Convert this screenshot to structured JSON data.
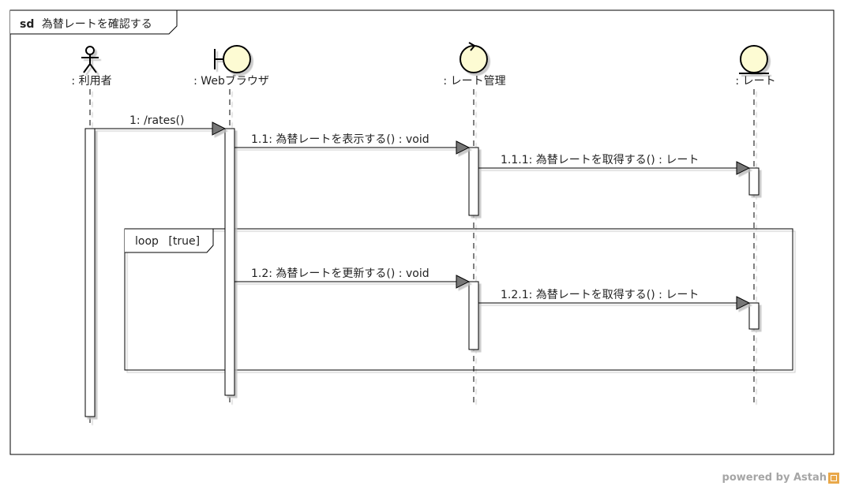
{
  "frame": {
    "keyword": "sd",
    "name": "為替レートを確認する"
  },
  "lifelines": [
    {
      "id": "user",
      "label": ": 利用者",
      "stereotype": "actor"
    },
    {
      "id": "browser",
      "label": ": Webブラウザ",
      "stereotype": "boundary"
    },
    {
      "id": "manager",
      "label": ": レート管理",
      "stereotype": "control"
    },
    {
      "id": "rate",
      "label": ": レート",
      "stereotype": "entity"
    }
  ],
  "messages": [
    {
      "label": "1: /rates()"
    },
    {
      "label": "1.1: 為替レートを表示する() : void"
    },
    {
      "label": "1.1.1: 為替レートを取得する() : レート"
    },
    {
      "label": "1.2: 為替レートを更新する() : void"
    },
    {
      "label": "1.2.1: 為替レートを取得する() : レート"
    }
  ],
  "fragment": {
    "operator": "loop",
    "guard": "[true]"
  },
  "footer": {
    "powered_by": "powered by Astah"
  },
  "colors": {
    "head_fill": "#fdfbd3",
    "stroke": "#000000",
    "arrow_fill": "#777777"
  }
}
